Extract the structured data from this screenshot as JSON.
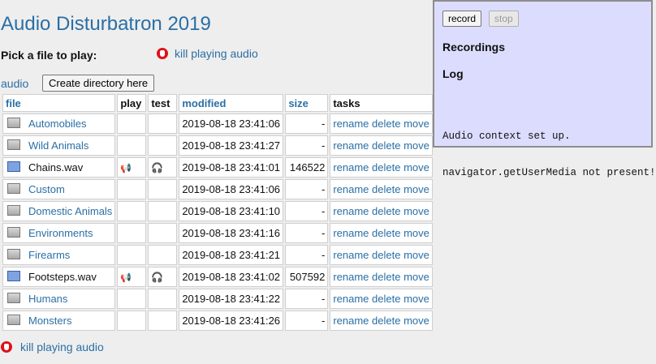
{
  "app": {
    "title": "Audio Disturbatron 2019"
  },
  "pick_label": "Pick a file to play:",
  "kill_label": "kill playing audio",
  "breadcrumb": "audio",
  "create_dir_label": "Create directory here",
  "table": {
    "headers": {
      "file": "file",
      "play": "play",
      "test": "test",
      "modified": "modified",
      "size": "size",
      "tasks": "tasks"
    },
    "task_labels": {
      "rename": "rename",
      "delete": "delete",
      "move": "move"
    },
    "rows": [
      {
        "name": "Automobiles",
        "type": "folder",
        "modified": "2019-08-18 23:41:06",
        "size": "-"
      },
      {
        "name": "Wild Animals",
        "type": "folder",
        "modified": "2019-08-18 23:41:27",
        "size": "-"
      },
      {
        "name": "Chains.wav",
        "type": "audio",
        "modified": "2019-08-18 23:41:01",
        "size": "146522"
      },
      {
        "name": "Custom",
        "type": "folder",
        "modified": "2019-08-18 23:41:06",
        "size": "-"
      },
      {
        "name": "Domestic Animals",
        "type": "folder",
        "modified": "2019-08-18 23:41:10",
        "size": "-"
      },
      {
        "name": "Environments",
        "type": "folder",
        "modified": "2019-08-18 23:41:16",
        "size": "-"
      },
      {
        "name": "Firearms",
        "type": "folder",
        "modified": "2019-08-18 23:41:21",
        "size": "-"
      },
      {
        "name": "Footsteps.wav",
        "type": "audio",
        "modified": "2019-08-18 23:41:02",
        "size": "507592"
      },
      {
        "name": "Humans",
        "type": "folder",
        "modified": "2019-08-18 23:41:22",
        "size": "-"
      },
      {
        "name": "Monsters",
        "type": "folder",
        "modified": "2019-08-18 23:41:26",
        "size": "-"
      }
    ]
  },
  "panel": {
    "record_label": "record",
    "stop_label": "stop",
    "recordings_heading": "Recordings",
    "log_heading": "Log",
    "log_lines": [
      "Audio context set up.",
      "navigator.getUserMedia not present!"
    ]
  },
  "icons": {
    "folder": "folder-icon",
    "audio": "audio-file-icon",
    "play": "speaker-icon",
    "test": "headphones-icon",
    "kill": "stop-hand-icon"
  },
  "colors": {
    "link": "#2a6fa5",
    "kill_icon": "#e0101a",
    "panel_bg": "#dcdcff"
  }
}
